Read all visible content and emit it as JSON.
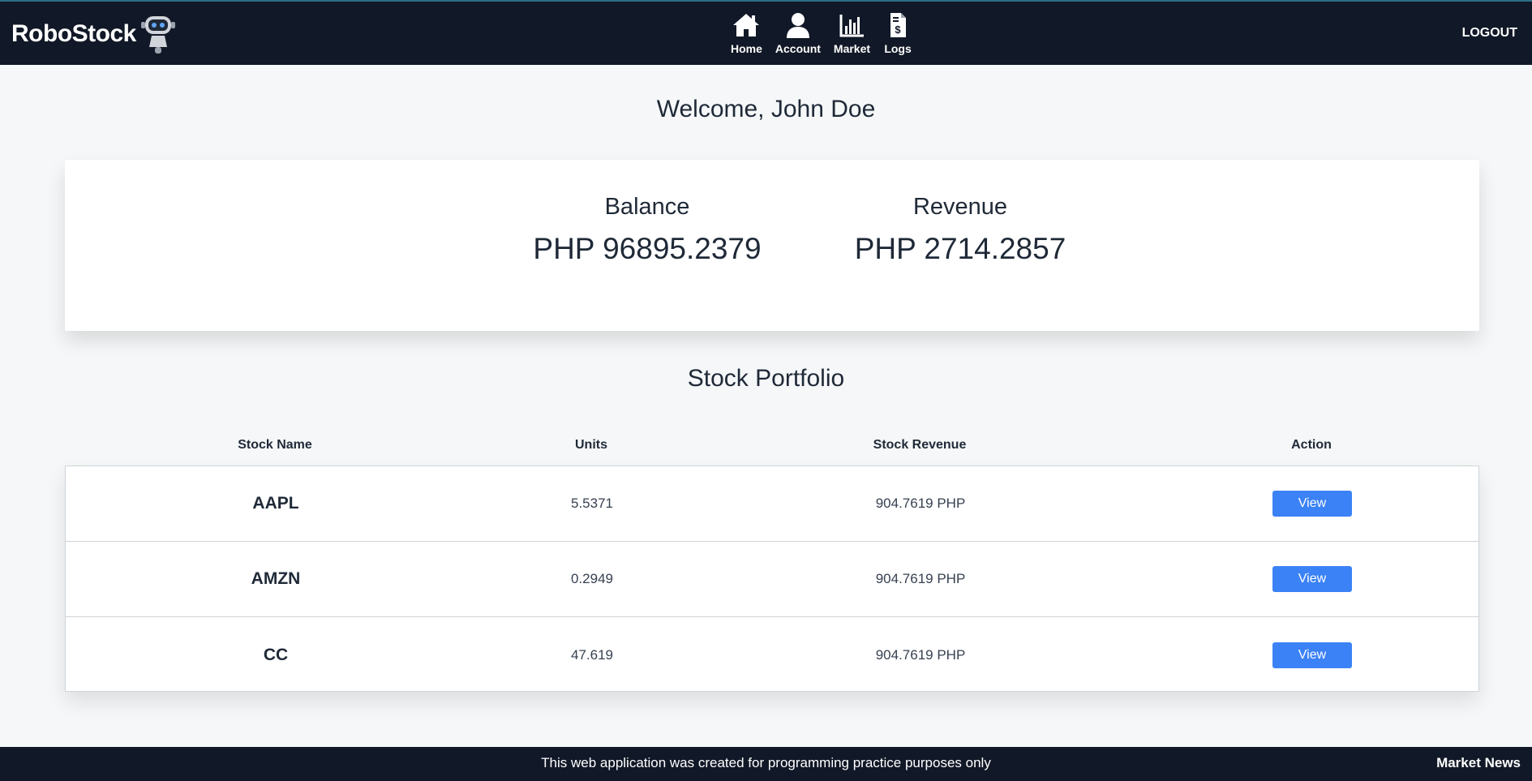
{
  "header": {
    "brand": "RoboStock",
    "nav": [
      {
        "label": "Home",
        "icon": "home-icon"
      },
      {
        "label": "Account",
        "icon": "user-icon"
      },
      {
        "label": "Market",
        "icon": "bar-chart-icon"
      },
      {
        "label": "Logs",
        "icon": "receipt-icon"
      }
    ],
    "logout": "LOGOUT"
  },
  "welcome": "Welcome, John Doe",
  "summary": {
    "balance_label": "Balance",
    "balance_value": "PHP 96895.2379",
    "revenue_label": "Revenue",
    "revenue_value": "PHP 2714.2857"
  },
  "portfolio": {
    "title": "Stock Portfolio",
    "columns": [
      "Stock Name",
      "Units",
      "Stock Revenue",
      "Action"
    ],
    "rows": [
      {
        "name": "AAPL",
        "units": "5.5371",
        "revenue": "904.7619 PHP",
        "action": "View"
      },
      {
        "name": "AMZN",
        "units": "0.2949",
        "revenue": "904.7619 PHP",
        "action": "View"
      },
      {
        "name": "CC",
        "units": "47.619",
        "revenue": "904.7619 PHP",
        "action": "View"
      }
    ]
  },
  "footer": {
    "text": "This web application was created for programming practice purposes only",
    "market_news": "Market News"
  },
  "colors": {
    "navbar": "#111827",
    "button": "#3b82f6",
    "background": "#f5f7f8"
  }
}
